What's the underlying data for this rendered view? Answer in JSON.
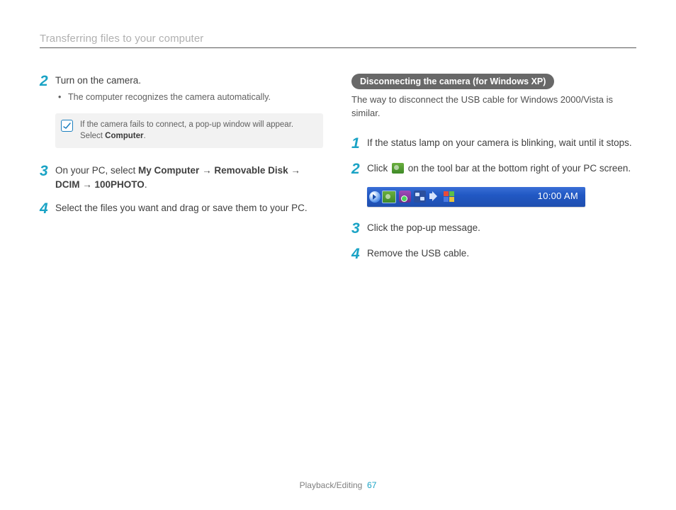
{
  "header": {
    "title": "Transferring files to your computer"
  },
  "left": {
    "step2": {
      "num": "2",
      "text": "Turn on the camera.",
      "bullet": "The computer recognizes the camera automatically."
    },
    "note": {
      "prefix": "If the camera fails to connect, a pop-up window will appear. Select ",
      "bold": "Computer",
      "suffix": "."
    },
    "step3": {
      "num": "3",
      "prefix": "On your PC, select ",
      "b1": "My Computer",
      "arrow1": " → ",
      "b2": "Removable Disk",
      "arrow2": " → ",
      "b3": "DCIM",
      "arrow3": " → ",
      "b4": "100PHOTO",
      "suffix": "."
    },
    "step4": {
      "num": "4",
      "text": "Select the files you want and drag or save them to your PC."
    }
  },
  "right": {
    "pill": "Disconnecting the camera (for Windows XP)",
    "subtext": "The way to disconnect the USB cable for Windows 2000/Vista is similar.",
    "step1": {
      "num": "1",
      "text": "If the status lamp on your camera is blinking, wait until it stops."
    },
    "step2": {
      "num": "2",
      "prefix": "Click ",
      "suffix": " on the tool bar at the bottom right of your PC screen."
    },
    "taskbar": {
      "time": "10:00 AM"
    },
    "step3": {
      "num": "3",
      "text": "Click the pop-up message."
    },
    "step4": {
      "num": "4",
      "text": "Remove the USB cable."
    }
  },
  "footer": {
    "section": "Playback/Editing",
    "page": "67"
  }
}
